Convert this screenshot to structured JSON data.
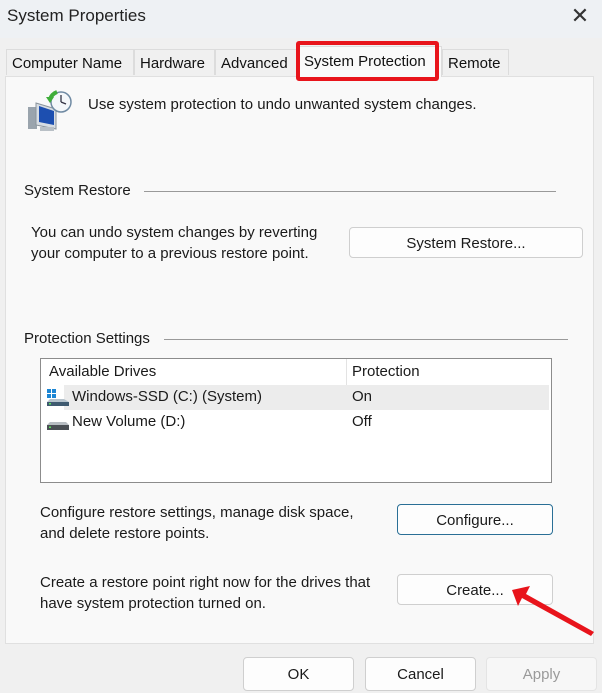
{
  "window": {
    "title": "System Properties",
    "close_icon": "close-icon"
  },
  "tabs": [
    {
      "label": "Computer Name",
      "active": false
    },
    {
      "label": "Hardware",
      "active": false
    },
    {
      "label": "Advanced",
      "active": false
    },
    {
      "label": "System Protection",
      "active": true
    },
    {
      "label": "Remote",
      "active": false
    }
  ],
  "highlight_color": "#e8141b",
  "intro": {
    "icon": "system-protection-icon",
    "text": "Use system protection to undo unwanted system changes."
  },
  "system_restore": {
    "group_title": "System Restore",
    "description_line1": "You can undo system changes by reverting",
    "description_line2": "your computer to a previous restore point.",
    "button_label": "System Restore..."
  },
  "protection_settings": {
    "group_title": "Protection Settings",
    "columns": [
      "Available Drives",
      "Protection"
    ],
    "drives": [
      {
        "name": "Windows-SSD (C:) (System)",
        "protection": "On",
        "icon": "system-drive-icon",
        "selected": true
      },
      {
        "name": "New Volume (D:)",
        "protection": "Off",
        "icon": "drive-icon",
        "selected": false
      }
    ],
    "configure": {
      "description_line1": "Configure restore settings, manage disk space,",
      "description_line2": "and delete restore points.",
      "button_label": "Configure..."
    },
    "create": {
      "description_line1": "Create a restore point right now for the drives that",
      "description_line2": "have system protection turned on.",
      "button_label": "Create..."
    }
  },
  "footer": {
    "ok_label": "OK",
    "cancel_label": "Cancel",
    "apply_label": "Apply"
  },
  "annotation": {
    "arrow_color": "#e8141b",
    "points_to": "Create..."
  }
}
